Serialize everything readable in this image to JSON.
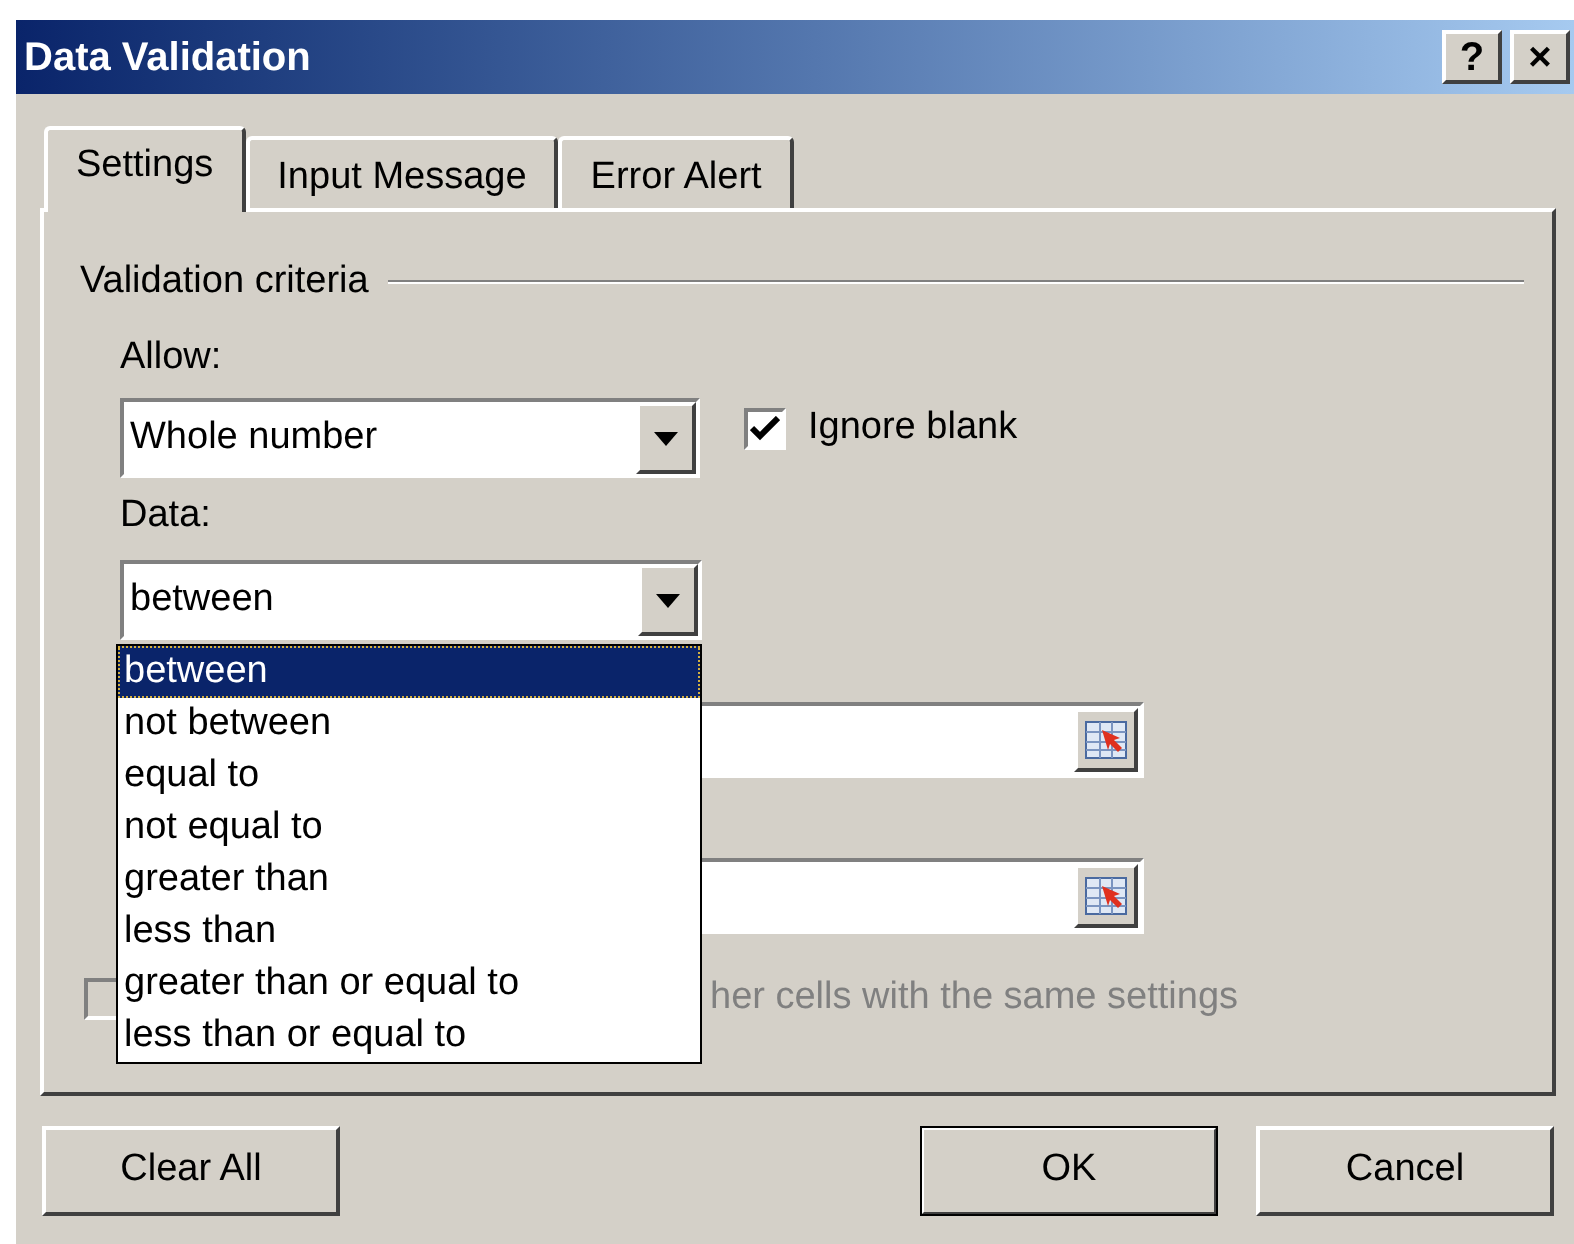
{
  "window": {
    "title": "Data Validation",
    "title_buttons": [
      {
        "label": "?"
      },
      {
        "label": "×"
      }
    ]
  },
  "tabs": [
    {
      "label": "Settings",
      "selected": true
    },
    {
      "label": "Input Message",
      "selected": false
    },
    {
      "label": "Error Alert",
      "selected": false
    }
  ],
  "section_title": "Validation criteria",
  "allow": {
    "label": "Allow:",
    "value": "Whole number"
  },
  "ignore_blank": {
    "label": "Ignore blank",
    "checked": true
  },
  "data": {
    "label": "Data:",
    "value": "between",
    "expanded": true,
    "options": [
      {
        "label": "between",
        "selected": true
      },
      {
        "label": "not between",
        "selected": false
      },
      {
        "label": "equal to",
        "selected": false
      },
      {
        "label": "not equal to",
        "selected": false
      },
      {
        "label": "greater than",
        "selected": false
      },
      {
        "label": "less than",
        "selected": false
      },
      {
        "label": "greater than or equal to",
        "selected": false
      },
      {
        "label": "less than or equal to",
        "selected": false
      }
    ]
  },
  "apply_to_all": {
    "label": "her cells with the same settings",
    "checked": false,
    "disabled": true
  },
  "buttons": [
    {
      "label": "Clear All",
      "default": false
    },
    {
      "label": "OK",
      "default": true
    },
    {
      "label": "Cancel",
      "default": false
    }
  ]
}
